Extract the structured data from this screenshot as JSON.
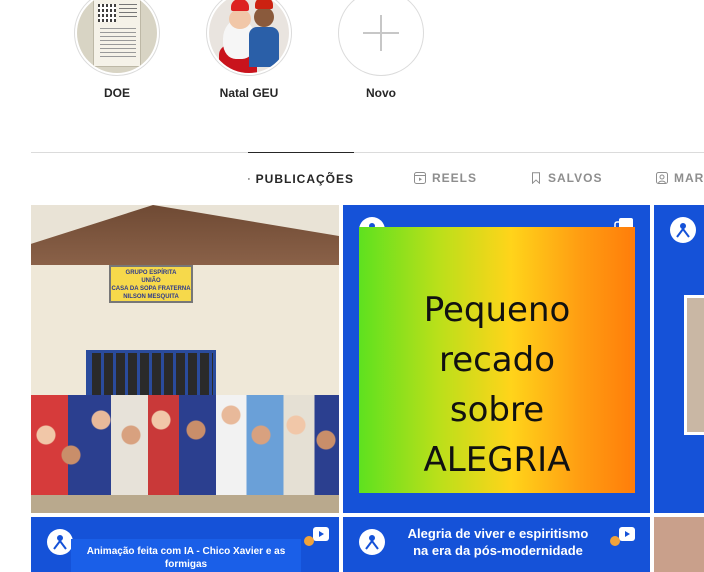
{
  "highlights": [
    {
      "label": "DOE"
    },
    {
      "label": "Natal GEU"
    },
    {
      "label": "Novo"
    }
  ],
  "tabs": [
    {
      "label": "PUBLICAÇÕES",
      "icon": "grid-icon",
      "active": true
    },
    {
      "label": "REELS",
      "icon": "reels-icon",
      "active": false
    },
    {
      "label": "SALVOS",
      "icon": "bookmark-icon",
      "active": false
    },
    {
      "label": "MAR",
      "icon": "tagged-icon",
      "active": false
    }
  ],
  "posts": {
    "p1": {
      "sign_line1": "GRUPO ESPÍRITA",
      "sign_line2": "UNIÃO",
      "sign_line3": "CASA DA SOPA FRATERNA",
      "sign_line4": "NILSON MESQUITA"
    },
    "p2": {
      "line1": "Pequeno",
      "line2": "recado",
      "line3": "sobre",
      "line4": "ALEGRIA"
    },
    "p4": {
      "caption": "Animação feita com IA - Chico Xavier e as formigas"
    },
    "p5": {
      "caption_line1": "Alegria de viver e espiritismo",
      "caption_line2": "na era da pós-modernidade"
    }
  },
  "colors": {
    "accent_blue": "#1552d8",
    "text": "#262626",
    "muted": "#8e8e8e"
  }
}
